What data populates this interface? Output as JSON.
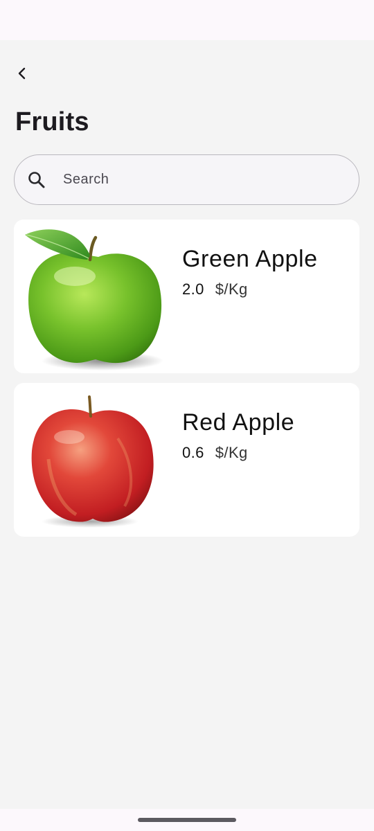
{
  "header": {
    "title": "Fruits",
    "back_icon": "chevron-left-icon"
  },
  "search": {
    "placeholder": "Search",
    "value": "",
    "icon": "search-icon"
  },
  "products": [
    {
      "name": "Green Apple",
      "price": "2.0",
      "unit": "$/Kg",
      "image": "green-apple-image"
    },
    {
      "name": "Red Apple",
      "price": "0.6",
      "unit": "$/Kg",
      "image": "red-apple-image"
    }
  ],
  "colors": {
    "background": "#f4f4f4",
    "card": "#ffffff",
    "search_border": "#b9b7bd",
    "text": "#1d1b20"
  }
}
